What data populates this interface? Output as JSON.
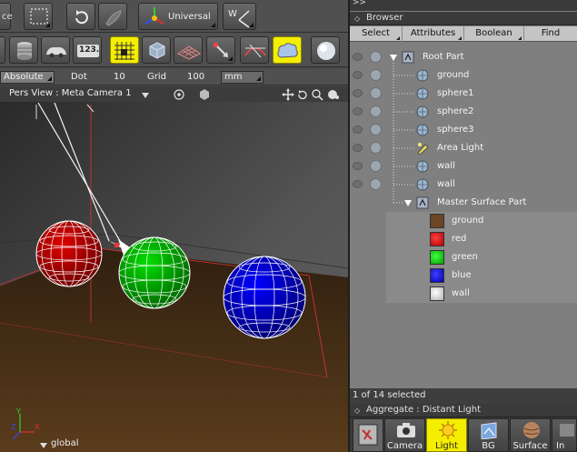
{
  "toolbar": {
    "universal_label": "Universal",
    "preview_label": "123.",
    "partial_left_label": "ce"
  },
  "row3": {
    "mode_value": "Absolute",
    "dot_label": "Dot",
    "dot_value": "10",
    "grid_label": "Grid",
    "grid_value": "100",
    "unit_value": "mm"
  },
  "viewport": {
    "title": "Pers View : Meta Camera 1",
    "global_label": "global"
  },
  "browser": {
    "top_marker": ">>",
    "title": "Browser",
    "tabs": [
      "Select",
      "Attributes",
      "Boolean",
      "Find"
    ],
    "items": [
      {
        "label": "Root Part",
        "icon": "part-icon"
      },
      {
        "label": "ground",
        "icon": "shape-icon"
      },
      {
        "label": "sphere1",
        "icon": "shape-icon"
      },
      {
        "label": "sphere2",
        "icon": "shape-icon"
      },
      {
        "label": "sphere3",
        "icon": "shape-icon"
      },
      {
        "label": "Area Light",
        "icon": "light-icon"
      },
      {
        "label": "wall",
        "icon": "shape-icon"
      },
      {
        "label": "wall",
        "icon": "shape-icon"
      },
      {
        "label": "Master Surface Part",
        "icon": "part-icon"
      },
      {
        "label": "ground",
        "icon": "swatch-icon",
        "color": "#6b4524"
      },
      {
        "label": "red",
        "icon": "swatch-icon",
        "color": "#e00000"
      },
      {
        "label": "green",
        "icon": "swatch-icon",
        "color": "#00c000"
      },
      {
        "label": "blue",
        "icon": "swatch-icon",
        "color": "#0000d8"
      },
      {
        "label": "wall",
        "icon": "swatch-icon",
        "color": "#e8e8e8"
      }
    ],
    "status": "1 of 14 selected"
  },
  "aggregate": {
    "title": "Aggregate : Distant Light",
    "buttons": [
      "Camera",
      "Light",
      "BG",
      "Surface",
      "In"
    ]
  },
  "colors": {
    "highlight": "#f4ee00",
    "sphere_red": "#c00000",
    "sphere_green": "#00b000",
    "sphere_blue": "#0000c8"
  }
}
